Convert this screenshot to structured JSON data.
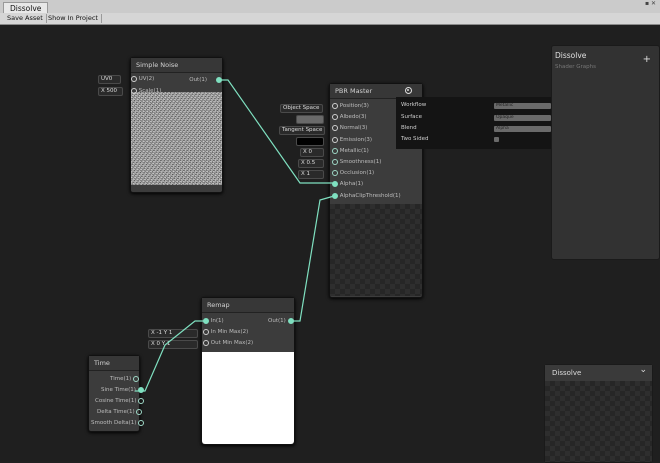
{
  "window": {
    "tab_title": "Dissolve",
    "controls": "▪ ✕",
    "toolbar": {
      "save_asset": "Save Asset",
      "show_in_project": "Show In Project"
    }
  },
  "colors": {
    "wire": "#7fe0c0",
    "canvas": "#1f1f1f",
    "node": "#3c3c3c"
  },
  "nodes": {
    "simple_noise": {
      "title": "Simple Noise",
      "inputs": [
        {
          "field": "UV0",
          "label": "UV(2)"
        },
        {
          "field": "X 500",
          "label": "Scale(1)"
        }
      ],
      "output": "Out(1)"
    },
    "pbr_master": {
      "title": "PBR Master",
      "settings_icon": "gear-icon",
      "inputs": [
        {
          "field": "Object Space",
          "label": "Position(3)"
        },
        {
          "field": "",
          "label": "Albedo(3)"
        },
        {
          "field": "Tangent Space",
          "label": "Normal(3)"
        },
        {
          "field": "",
          "label": "Emission(3)"
        },
        {
          "field": "X 0",
          "label": "Metallic(1)"
        },
        {
          "field": "X 0.5",
          "label": "Smoothness(1)"
        },
        {
          "field": "X 1",
          "label": "Occlusion(1)"
        },
        {
          "field": "",
          "label": "Alpha(1)"
        },
        {
          "field": "",
          "label": "AlphaClipThreshold(1)"
        }
      ],
      "settings": [
        {
          "label": "Workflow",
          "value": "Metallic"
        },
        {
          "label": "Surface",
          "value": "Opaque"
        },
        {
          "label": "Blend",
          "value": "Alpha"
        },
        {
          "label": "Two Sided",
          "value": ""
        }
      ]
    },
    "remap": {
      "title": "Remap",
      "inputs": [
        {
          "field": "",
          "label": "In(1)"
        },
        {
          "field": "X -1   Y 1",
          "label": "In Min Max(2)"
        },
        {
          "field": "X 0   Y 1",
          "label": "Out Min Max(2)"
        }
      ],
      "output": "Out(1)"
    },
    "time": {
      "title": "Time",
      "outputs": [
        "Time(1)",
        "Sine Time(1)",
        "Cosine Time(1)",
        "Delta Time(1)",
        "Smooth Delta(1)"
      ]
    }
  },
  "blackboard": {
    "title": "Dissolve",
    "subtitle": "Shader Graphs",
    "add_label": "+"
  },
  "main_preview": {
    "title": "Dissolve",
    "chevron": "⌄"
  }
}
